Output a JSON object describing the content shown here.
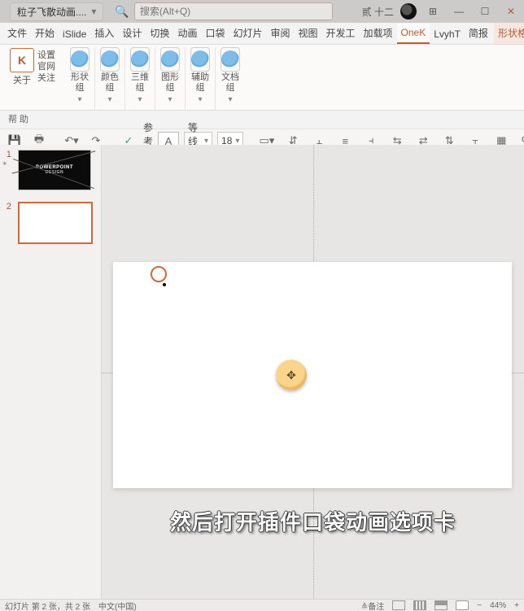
{
  "titlebar": {
    "filename": "粒子飞散动画....",
    "search_icon": "search-icon",
    "search_placeholder": "搜索(Alt+Q)",
    "user_label": "贰 十二",
    "win_min": "—",
    "win_max": "☐",
    "win_close": "✕",
    "grid_icon": "⊞"
  },
  "menutabs": {
    "items": [
      "文件",
      "开始",
      "iSlide",
      "插入",
      "设计",
      "切换",
      "动画",
      "口袋",
      "幻灯片",
      "审阅",
      "视图",
      "开发工",
      "加载项",
      "OneK",
      "LvyhT",
      "简报"
    ],
    "active_index": 13,
    "shape_fmt_label": "形状格式",
    "share_icon": "share-icon",
    "comment_icon": "comment-icon"
  },
  "ribbon": {
    "k_group": {
      "icon_text": "K",
      "about_label": "关于",
      "set_label": "设置",
      "guanwang": "官网",
      "guanzhu": "关注"
    },
    "groups": [
      {
        "label_top": "形状",
        "label_bot": "组"
      },
      {
        "label_top": "颜色",
        "label_bot": "组"
      },
      {
        "label_top": "三维",
        "label_bot": "组"
      },
      {
        "label_top": "图形",
        "label_bot": "组"
      },
      {
        "label_top": "辅助",
        "label_bot": "组"
      },
      {
        "label_top": "文档",
        "label_bot": "组"
      }
    ],
    "help_label": "帮 助"
  },
  "toolbar2": {
    "save_icon": "save-icon",
    "print_icon": "print-icon",
    "undo": "undo-icon",
    "redo": "redo-icon",
    "guide_check": "✓",
    "guide_label": "参考线",
    "textfield_icon": "A",
    "font_name": "等线 (正",
    "font_size": "18",
    "icons_rest": [
      "fill",
      "align-h",
      "align-v",
      "align-l",
      "align-r",
      "dist-h",
      "swap",
      "dist-v",
      "align-t",
      "snap",
      "link",
      "more"
    ]
  },
  "thumbs": {
    "items": [
      {
        "idx": "1",
        "title1": "POWERPOINT",
        "title2": "DESIGN",
        "selected": false,
        "dark": true,
        "starred": true
      },
      {
        "idx": "2",
        "title1": "",
        "title2": "",
        "selected": true,
        "dark": false,
        "starred": false
      }
    ]
  },
  "caption_text": "然后打开插件口袋动画选项卡",
  "statusbar": {
    "left": "幻灯片 第 2 张，共 2 张",
    "acc": "",
    "lang": "中文(中国)",
    "notes": "≙备注",
    "view_icons": [
      "normal-view",
      "sorter-view",
      "reading-view",
      "slideshow-view"
    ],
    "zoom_minus": "−",
    "zoom_pct": "44%",
    "zoom_plus": "+"
  }
}
